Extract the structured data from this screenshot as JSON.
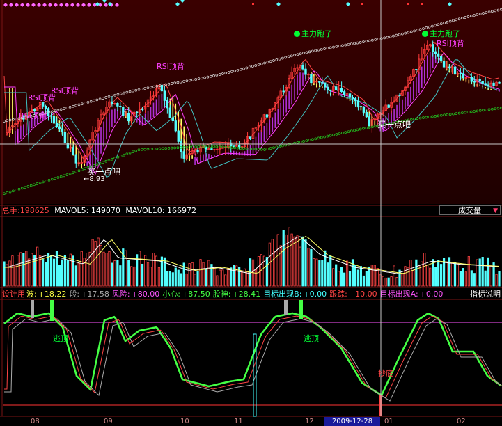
{
  "colors": {
    "background": "#000000",
    "price_panel_top": "#3a0000",
    "price_panel_bottom": "#220000",
    "panel_border": "#7a1515",
    "crosshair": "#c8c8c8",
    "up_candle": "#ff3a3a",
    "down_candle": "#54ffff",
    "envelope_purple": "#b030d8",
    "envelope_yellow": "#ffff66",
    "dotted_upper": "#dddddd",
    "dotted_lower": "#22cc22",
    "label_green": "#00ff33",
    "label_magenta": "#ff40ff",
    "label_white": "#ffffff"
  },
  "price_panel": {
    "annotations": {
      "rsi_top_1": "RSI顶背",
      "rsi_top_2": "RSI顶背",
      "rsi_top_3": "RSI顶背",
      "rsi_top_4": "RSI顶背",
      "rsi_top_5": "RSI顶背",
      "main_run_1": "主力跑了",
      "main_run_2": "主力跑了",
      "buy_1": "买一点吧",
      "buy_2": "买一点吧",
      "low_price": "←8.93"
    }
  },
  "volume_panel": {
    "total_label": "总手:",
    "total_value": "198625",
    "mavol5_label": "MAVOL5:",
    "mavol5_value": "149070",
    "mavol10_label": "MAVOL10:",
    "mavol10_value": "166972",
    "dropdown_label": "成交量",
    "dropdown_arrow": "▼"
  },
  "indicator_panel": {
    "items": [
      {
        "label": "设计用",
        "value": "",
        "color": "#ff4444"
      },
      {
        "label": "波:",
        "value": "+18.22",
        "color": "#ffff44"
      },
      {
        "label": "段:",
        "value": "+17.58",
        "color": "#aaaaaa"
      },
      {
        "label": "风险:",
        "value": "+80.00",
        "color": "#ff55ff"
      },
      {
        "label": "小心:",
        "value": "+87.50",
        "color": "#44ff44"
      },
      {
        "label": "股神:",
        "value": "+28.41",
        "color": "#44ff44"
      },
      {
        "label": "目标出现B:",
        "value": "+0.00",
        "color": "#44ffff"
      },
      {
        "label": "跟踪:",
        "value": "+10.00",
        "color": "#ff4444"
      },
      {
        "label": "目标出现A:",
        "value": "+0.00",
        "color": "#ff55ff"
      }
    ],
    "help_label": "指标说明",
    "annotations": {
      "escape_1": "逃顶",
      "escape_2": "逃顶",
      "bottom_1": "抄底"
    }
  },
  "x_axis": {
    "ticks": [
      {
        "label": "08"
      },
      {
        "label": "09"
      },
      {
        "label": "10"
      },
      {
        "label": "11"
      },
      {
        "label": "12"
      },
      {
        "label": "01"
      },
      {
        "label": "02"
      }
    ],
    "cursor_date": "2009-12-28"
  }
}
